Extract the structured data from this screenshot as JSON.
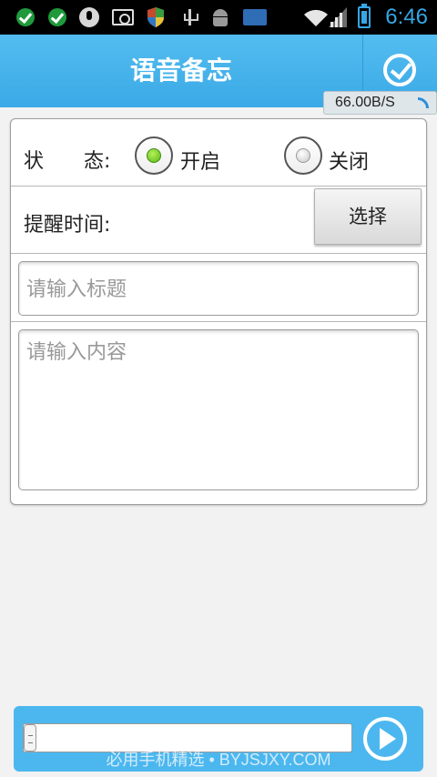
{
  "status_bar": {
    "time": "6:46",
    "icons": [
      "check-icon",
      "check-icon",
      "mic-icon",
      "camera-icon",
      "shield-icon",
      "usb-icon",
      "android-icon",
      "keyboard-icon",
      "wifi-icon",
      "signal-icon",
      "battery-icon"
    ],
    "accent_color": "#35a7e5"
  },
  "header": {
    "title": "语音备忘",
    "confirm_icon": "check-circle-icon",
    "speed": "66.00B/S",
    "background_color": "#3aa9e6"
  },
  "form": {
    "status_label": "状　　态:",
    "status_options": [
      {
        "label": "开启",
        "selected": true
      },
      {
        "label": "关闭",
        "selected": false
      }
    ],
    "reminder_label": "提醒时间:",
    "select_button": "选择",
    "title_placeholder": "请输入标题",
    "content_placeholder": "请输入内容"
  },
  "bottom_bar": {
    "play_icon": "play-circle-icon",
    "watermark": "必用手机精选 • BYJSJXY.COM"
  }
}
